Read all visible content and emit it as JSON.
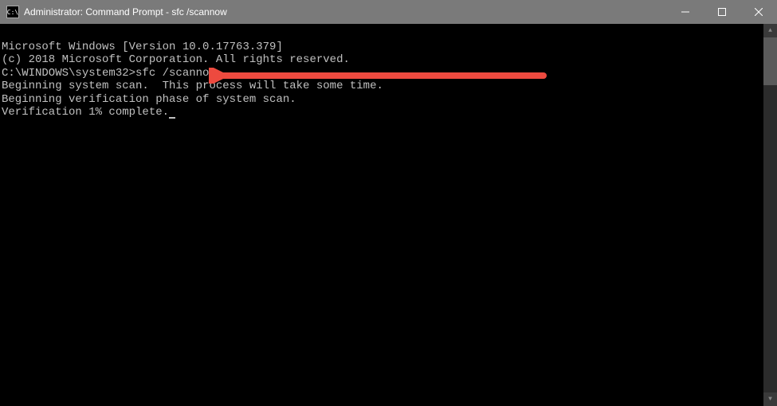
{
  "titlebar": {
    "icon_label": "C:\\",
    "title": "Administrator: Command Prompt - sfc  /scannow"
  },
  "terminal": {
    "line1": "Microsoft Windows [Version 10.0.17763.379]",
    "line2": "(c) 2018 Microsoft Corporation. All rights reserved.",
    "blank1": "",
    "prompt_line": "C:\\WINDOWS\\system32>sfc /scannow",
    "blank2": "",
    "scan_msg": "Beginning system scan.  This process will take some time.",
    "blank3": "",
    "verify_msg": "Beginning verification phase of system scan.",
    "progress_msg": "Verification 1% complete."
  }
}
